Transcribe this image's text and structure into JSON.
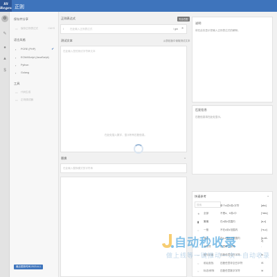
{
  "app": {
    "logo_text": "Hi\nRegex",
    "title": "正则"
  },
  "rail": {
    "icons": [
      "gear-icon",
      "wrench-icon",
      "user-icon",
      "flask-icon",
      "dollar-icon"
    ]
  },
  "sidebar": {
    "save_section": "保存并分享",
    "save_item": {
      "label": "保存正则表达式",
      "tag": "Ctrl+S"
    },
    "flavor_section": "语言风格",
    "flavors": [
      {
        "label": "PCRE (PHP)",
        "selected": true
      },
      {
        "label": "ECMAScript (JavaScript)",
        "selected": false
      },
      {
        "label": "Python",
        "selected": false
      },
      {
        "label": "Golang",
        "selected": false
      }
    ],
    "tools_section": "工具",
    "tools": [
      "代码生成",
      "正则调试器"
    ],
    "status": "最近更新时间:2023-6-1"
  },
  "regex": {
    "header": "正则表达式",
    "badge": "完全匹配",
    "placeholder": "在此输入正则表达式",
    "delimiter_open": "/",
    "flags": "/ gm",
    "flags_icon": "flag-icon"
  },
  "test": {
    "header": "测试文本",
    "action": "从剪贴板中读取测试文本",
    "placeholder": "在此输入您的测试字符串文本",
    "center_hint": "在此处插入数字，显示所有匹配信息。"
  },
  "replace": {
    "header": "替换",
    "placeholder": "在此输入替换模式的字符串"
  },
  "explain": {
    "header": "说明",
    "text": "将在此处显示您输入正则表达式的解释。"
  },
  "match": {
    "header": "匹配信息",
    "text": "匹配信息将在此处显示。"
  },
  "quickref": {
    "header": "快速参考",
    "search_placeholder": "搜索",
    "rows": [
      {
        "icon": "star-icon",
        "label": "全部",
        "desc": "单个a或b或c字符",
        "code": "[abc]"
      },
      {
        "icon": "dot-icon",
        "label": "常用",
        "desc": "不是a、b或c中",
        "code": "[^abc]"
      },
      {
        "icon": "dot-icon",
        "label": "一般",
        "desc": "在a到z范围内",
        "code": "[a-z]"
      },
      {
        "icon": "dot-icon",
        "label": "锚点",
        "desc": "不在a到z范围内",
        "code": "[^a-z]"
      },
      {
        "icon": "dot-icon",
        "label": "元字符",
        "desc": "在a-z或A-Z范围内",
        "code": "[a-zA-Z]"
      },
      {
        "icon": "dot-icon",
        "label": "组与引用",
        "desc": "任意单个字符",
        "code": "."
      },
      {
        "icon": "dot-icon",
        "label": "前后查找",
        "desc": "匹配任意空白字符",
        "code": "\\s"
      },
      {
        "icon": "dot-icon",
        "label": "量词",
        "desc": "匹配任意非空白字符",
        "code": "\\S"
      },
      {
        "icon": "dot-icon",
        "label": "标志/修饰",
        "desc": "匹配任意数字字符",
        "code": "\\d"
      }
    ]
  },
  "watermark": {
    "text": "自动秒收录",
    "slogan": "做上线等一键推动一次一自动收录"
  }
}
